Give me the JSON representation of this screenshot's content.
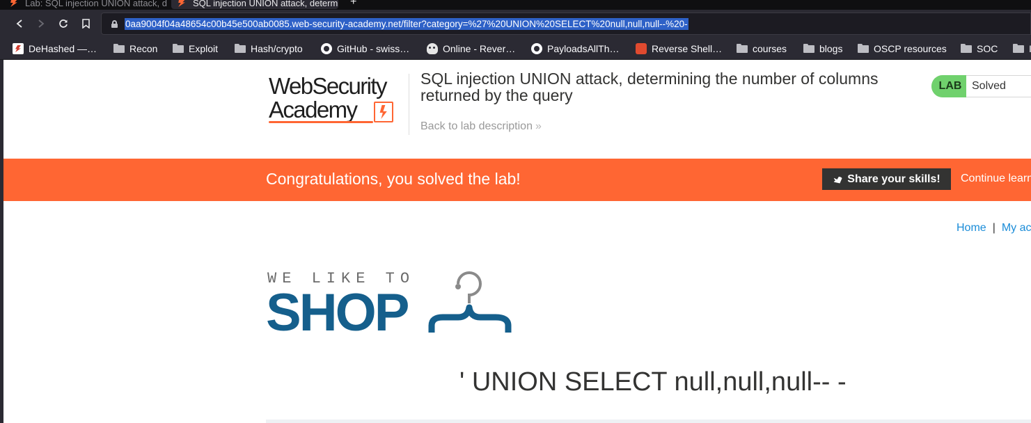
{
  "browser": {
    "tabs": [
      {
        "title": "Lab: SQL injection UNION attack, determining…",
        "active": false
      },
      {
        "title": "SQL injection UNION attack, determining…",
        "active": true
      }
    ],
    "new_tab_label": "+",
    "url": "0aa9004f04a48654c00b45e500ab0085.web-security-academy.net/filter?category=%27%20UNION%20SELECT%20null,null,null--%20-",
    "bookmarks": [
      {
        "label": "DeHashed —…",
        "icon": "dehashed-icon"
      },
      {
        "label": "Recon",
        "icon": "folder-icon"
      },
      {
        "label": "Exploit",
        "icon": "folder-icon"
      },
      {
        "label": "Hash/crypto",
        "icon": "folder-icon"
      },
      {
        "label": "GitHub - swiss…",
        "icon": "github-icon"
      },
      {
        "label": "Online - Rever…",
        "icon": "skull-icon"
      },
      {
        "label": "PayloadsAllTh…",
        "icon": "github-icon"
      },
      {
        "label": "Reverse Shell…",
        "icon": "reverse-shell-icon"
      },
      {
        "label": "courses",
        "icon": "folder-icon"
      },
      {
        "label": "blogs",
        "icon": "folder-icon"
      },
      {
        "label": "OSCP resources",
        "icon": "folder-icon"
      },
      {
        "label": "SOC",
        "icon": "folder-icon"
      },
      {
        "label": "I",
        "icon": "folder-icon"
      }
    ]
  },
  "header": {
    "logo_line1": "WebSecurity",
    "logo_line2": "Academy",
    "lab_title": "SQL injection UNION attack, determining the number of columns returned by the query",
    "back_link": "Back to lab description",
    "back_chevron": "»",
    "lab_badge": "LAB",
    "lab_status": "Solved"
  },
  "banner": {
    "message": "Congratulations, you solved the lab!",
    "share_label": "Share your skills!",
    "continue_label": "Continue learning"
  },
  "nav": {
    "home": "Home",
    "separator": "|",
    "account": "My account"
  },
  "shop": {
    "tagline": "WE LIKE TO",
    "word": "SHOP"
  },
  "search_heading": "' UNION SELECT null,null,null-- -",
  "colors": {
    "accent": "#ff6633",
    "shop_blue": "#155f8c",
    "lab_green": "#70d16d",
    "link_blue": "#1a8cd8"
  }
}
